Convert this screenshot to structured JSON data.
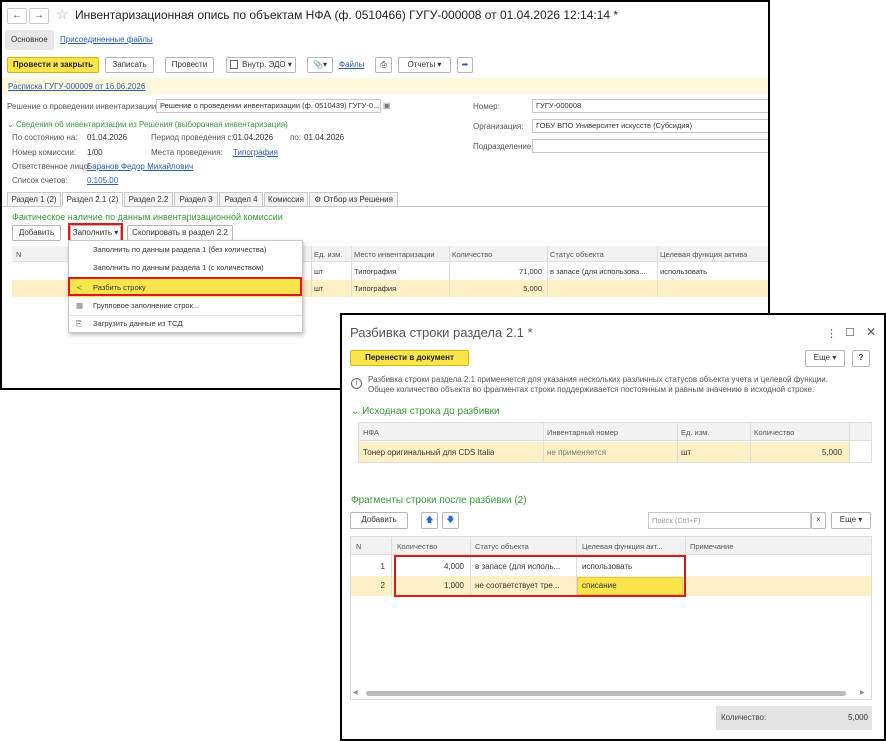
{
  "main": {
    "title": "Инвентаризационная опись по объектам НФА (ф. 0510466) ГУГУ-000008 от 01.04.2026 12:14:14 *",
    "tabs": [
      "Основное",
      "Присоединенные файлы"
    ],
    "toolbar": {
      "post_close": "Провести и закрыть",
      "save": "Записать",
      "post": "Провести",
      "edo": "Внутр. ЭДО",
      "files": "Файлы",
      "reports": "Отчеты"
    },
    "receipt_link": "Расписка ГУГУ-000009 от 16.06.2026",
    "decision_label": "Решение о проведении инвентаризации:",
    "decision_value": "Решение о проведении инвентаризации (ф. 0510439) ГУГУ-0...",
    "number_label": "Номер:",
    "number_value": "ГУГУ-000008",
    "org_label": "Организация:",
    "org_value": "ГОБУ ВПО Университет искусств (Субсидия)",
    "dept_label": "Подразделение:",
    "info_header": "Сведения об инвентаризации из Решения (выборочная инвентаризация)",
    "as_of_label": "По состоянию на:",
    "as_of_value": "01.04.2026",
    "period_label": "Период проведения с:",
    "period_from": "01.04.2026",
    "period_to_label": "по:",
    "period_to": "01.04.2026",
    "commission_label": "Номер комиссии:",
    "commission_value": "1/00",
    "places_label": "Места проведения:",
    "places_value": "Типография",
    "responsible_label": "Ответственное лицо:",
    "responsible_value": "Баранов Федор Михайлович",
    "accounts_label": "Список счетов:",
    "accounts_value": "0.105.00",
    "section_tabs": [
      "Раздел 1 (2)",
      "Раздел 2.1 (2)",
      "Раздел 2.2",
      "Раздел 3",
      "Раздел 4",
      "Комиссия",
      "Отбор из Решения"
    ],
    "section_subtitle": "Фактическое наличие по данным инвентаризационной комиссии",
    "add_btn": "Добавить",
    "fill_btn": "Заполнить",
    "copy_btn": "Скопировать в раздел 2.2",
    "grid_headers": [
      "N",
      "Ед. изм.",
      "Место инвентаризации",
      "Количество",
      "Статус объекта",
      "Целевая функция актива"
    ],
    "rows": [
      {
        "unit": "шт",
        "place": "Типография",
        "qty": "71,000",
        "status": "в запасе (для использова...",
        "func": "использовать"
      },
      {
        "unit": "шт",
        "place": "Типография",
        "qty": "5,000",
        "status": "",
        "func": ""
      }
    ],
    "menu": [
      "Заполнить по данным раздела 1 (без количества)",
      "Заполнить по данным раздела 1 (с количеством)",
      "Разбить строку",
      "Групповое заполнение строк...",
      "Загрузить данные из ТСД"
    ]
  },
  "dialog": {
    "title": "Разбивка строки раздела 2.1 *",
    "transfer_btn": "Перенести в документ",
    "more_btn": "Еще",
    "help_btn": "?",
    "info_text_1": "Разбивка строки раздела 2.1 применяется для указания нескольких различных статусов объекта учета и целевой функции.",
    "info_text_2": "Общее количество объекта во фрагментах строки поддерживается постоянным и равным значению в исходной строке.",
    "source_title": "Исходная строка до разбивки",
    "source_headers": [
      "НФА",
      "Инвентарный номер",
      "Ед. изм.",
      "Количество"
    ],
    "source_row": {
      "nfa": "Тонер оригинальный для CDS Italia",
      "inv": "не применяется",
      "unit": "шт",
      "qty": "5,000"
    },
    "fragments_title": "Фрагменты строки после разбивки (2)",
    "add_btn": "Добавить",
    "search_placeholder": "Поиск (Ctrl+F)",
    "frag_headers": [
      "N",
      "Количество",
      "Статус объекта",
      "Целевая функция акт...",
      "Примечание"
    ],
    "frag_rows": [
      {
        "n": "1",
        "qty": "4,000",
        "status": "в запасе (для исполь...",
        "func": "использовать"
      },
      {
        "n": "2",
        "qty": "1,000",
        "status": "не соответствует тре...",
        "func": "списание"
      }
    ],
    "total_label": "Количество:",
    "total_value": "5,000"
  }
}
